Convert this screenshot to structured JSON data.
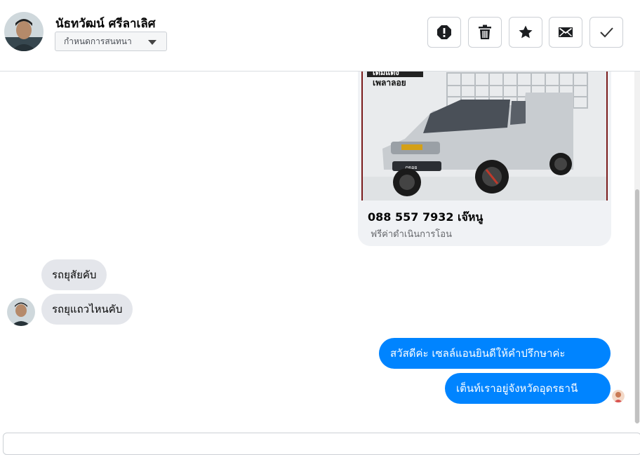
{
  "contact": {
    "name": "นัธทวัฒน์ ศรีลาเลิศ",
    "assign_label": "กำหนดการสนทนา"
  },
  "toolbar": {
    "spam_icon": "exclamation-icon",
    "delete_icon": "trash-icon",
    "star_icon": "star-icon",
    "unread_icon": "envelope-icon",
    "done_icon": "checkmark-icon"
  },
  "card": {
    "image_banner_top": "เติมแต่ง",
    "image_banner_bottom": "เพลาลอย",
    "plate": "ภูดอย",
    "title": "088 557 7932 เจ๊หนู",
    "subtitle": "ฟรีค่าดำเนินการโอน"
  },
  "messages": [
    {
      "direction": "incoming",
      "text": "รถยุสัยคับ"
    },
    {
      "direction": "incoming",
      "text": "รถยุแถวไหนคับ"
    },
    {
      "direction": "outgoing",
      "text": "สวัสดีค่ะ เซลล์แอนยินดีให้คำปรึกษาค่ะ"
    },
    {
      "direction": "outgoing",
      "text": "เต็นท์เราอยู่จังหวัดอุดรธานี"
    }
  ],
  "colors": {
    "accent": "#0084ff",
    "incoming_bubble": "#e4e6eb",
    "card_bg": "#f0f2f5"
  }
}
